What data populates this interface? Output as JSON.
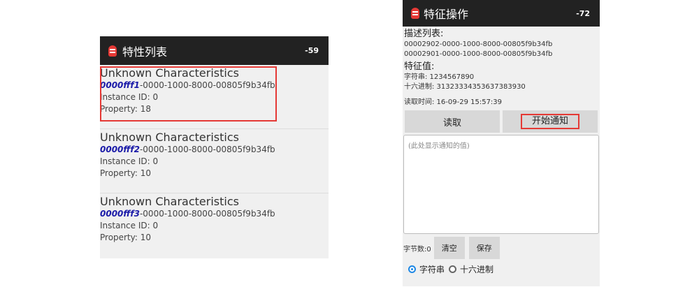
{
  "left": {
    "title": "特性列表",
    "rssi": "-59",
    "characteristics": [
      {
        "name": "Unknown Characteristics",
        "uuid_short": "0000fff1",
        "uuid_rest": "-0000-1000-8000-00805f9b34fb",
        "instance": "Instance ID: 0",
        "property": "Property: 18"
      },
      {
        "name": "Unknown Characteristics",
        "uuid_short": "0000fff2",
        "uuid_rest": "-0000-1000-8000-00805f9b34fb",
        "instance": "Instance ID: 0",
        "property": "Property: 10"
      },
      {
        "name": "Unknown Characteristics",
        "uuid_short": "0000fff3",
        "uuid_rest": "-0000-1000-8000-00805f9b34fb",
        "instance": "Instance ID: 0",
        "property": "Property: 10"
      }
    ]
  },
  "right": {
    "title": "特征操作",
    "rssi": "-72",
    "descriptor_label": "描述列表:",
    "descriptors": [
      "00002902-0000-1000-8000-00805f9b34fb",
      "00002901-0000-1000-8000-00805f9b34fb"
    ],
    "value_label": "特征值:",
    "string_value": "字符串: 1234567890",
    "hex_value": "十六进制: 31323334353637383930",
    "read_time": "读取时间: 16-09-29 15:57:39",
    "read_button": "读取",
    "notify_button": "开始通知",
    "notify_placeholder": "(此处显示通知的值)",
    "byte_count": "字节数:0",
    "clear_button": "清空",
    "save_button": "保存",
    "radio_string": "字符串",
    "radio_hex": "十六进制",
    "selected_format": "字符串"
  },
  "colors": {
    "highlight": "#e53935",
    "uuid_accent": "#1a1aa8",
    "appbar": "#222222"
  },
  "icons": {
    "app": "app-logo-icon"
  }
}
